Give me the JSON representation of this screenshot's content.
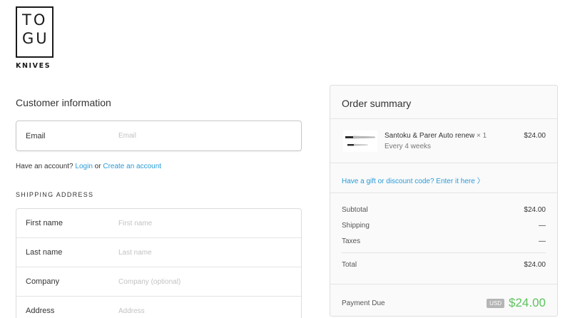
{
  "brand": {
    "logo_line1": "TO",
    "logo_line2": "GU",
    "logo_word": "KNIVES"
  },
  "customer": {
    "title": "Customer information",
    "email_label": "Email",
    "email_placeholder": "Email",
    "account_prompt": "Have an account?",
    "login_link": "Login",
    "or_text": "or",
    "create_link": "Create an account"
  },
  "shipping": {
    "title": "SHIPPING ADDRESS",
    "fields": [
      {
        "label": "First name",
        "placeholder": "First name"
      },
      {
        "label": "Last name",
        "placeholder": "Last name"
      },
      {
        "label": "Company",
        "placeholder": "Company (optional)"
      },
      {
        "label": "Address",
        "placeholder": "Address"
      }
    ]
  },
  "summary": {
    "title": "Order summary",
    "item": {
      "name": "Santoku & Parer Auto renew",
      "qty": "× 1",
      "subtitle": "Every 4 weeks",
      "price": "$24.00"
    },
    "discount_link": "Have a gift or discount code? Enter it here",
    "subtotal_label": "Subtotal",
    "subtotal_value": "$24.00",
    "shipping_label": "Shipping",
    "shipping_value": "—",
    "taxes_label": "Taxes",
    "taxes_value": "—",
    "total_label": "Total",
    "total_value": "$24.00",
    "due_label": "Payment Due",
    "currency": "USD",
    "due_value": "$24.00"
  },
  "colors": {
    "link": "#2a9bd6",
    "due_green": "#5ec25e"
  }
}
